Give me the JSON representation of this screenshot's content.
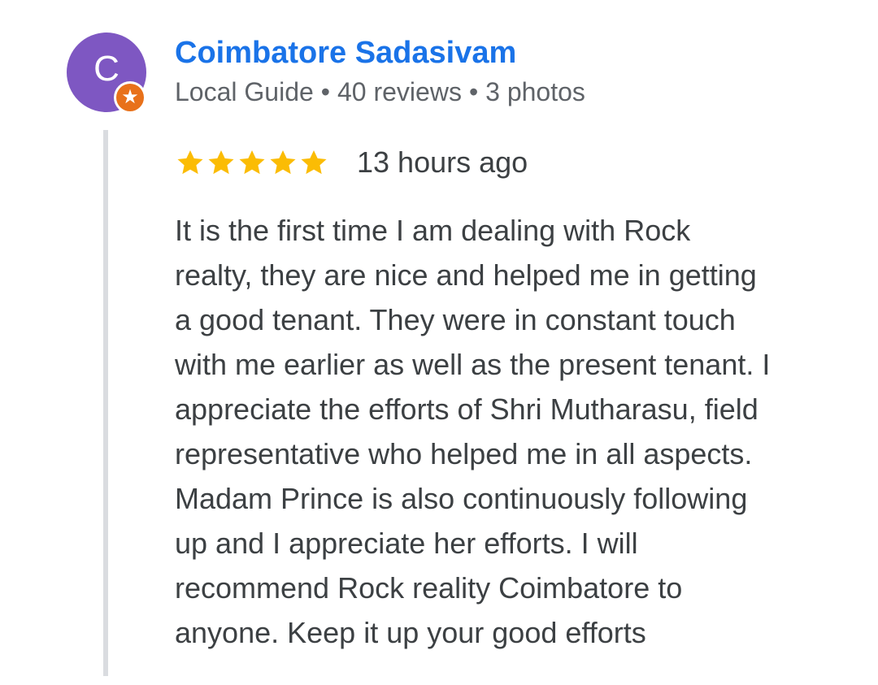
{
  "reviewer": {
    "initial": "C",
    "name": "Coimbatore Sadasivam",
    "level": "Local Guide",
    "reviews": "40 reviews",
    "photos": "3 photos",
    "meta_separator": "•",
    "badge_glyph": "★"
  },
  "review": {
    "rating": 5,
    "rating_max": 5,
    "time": "13 hours ago",
    "text_lines": [
      "It is the first time I am dealing with Rock",
      "realty, they are nice and helped me in getting",
      "a good tenant. They were in constant touch",
      "with me earlier as well as the present tenant. I",
      "appreciate the efforts of Shri Mutharasu, field",
      "representative who helped me in all aspects.",
      "Madam Prince is also continuously following",
      "up and I appreciate her efforts. I will",
      "recommend Rock reality Coimbatore to",
      "anyone. Keep it up your good efforts"
    ]
  },
  "icons": {
    "avatar": "avatar-letter",
    "badge": "local-guide-star-icon",
    "rating": "star-icon"
  },
  "colors": {
    "avatar_bg": "#7e57c2",
    "badge_bg": "#e8711a",
    "name": "#1a73e8",
    "meta": "#5f6368",
    "star": "#fbbc04",
    "body_text": "#3c4043",
    "rule": "#dadce0"
  }
}
